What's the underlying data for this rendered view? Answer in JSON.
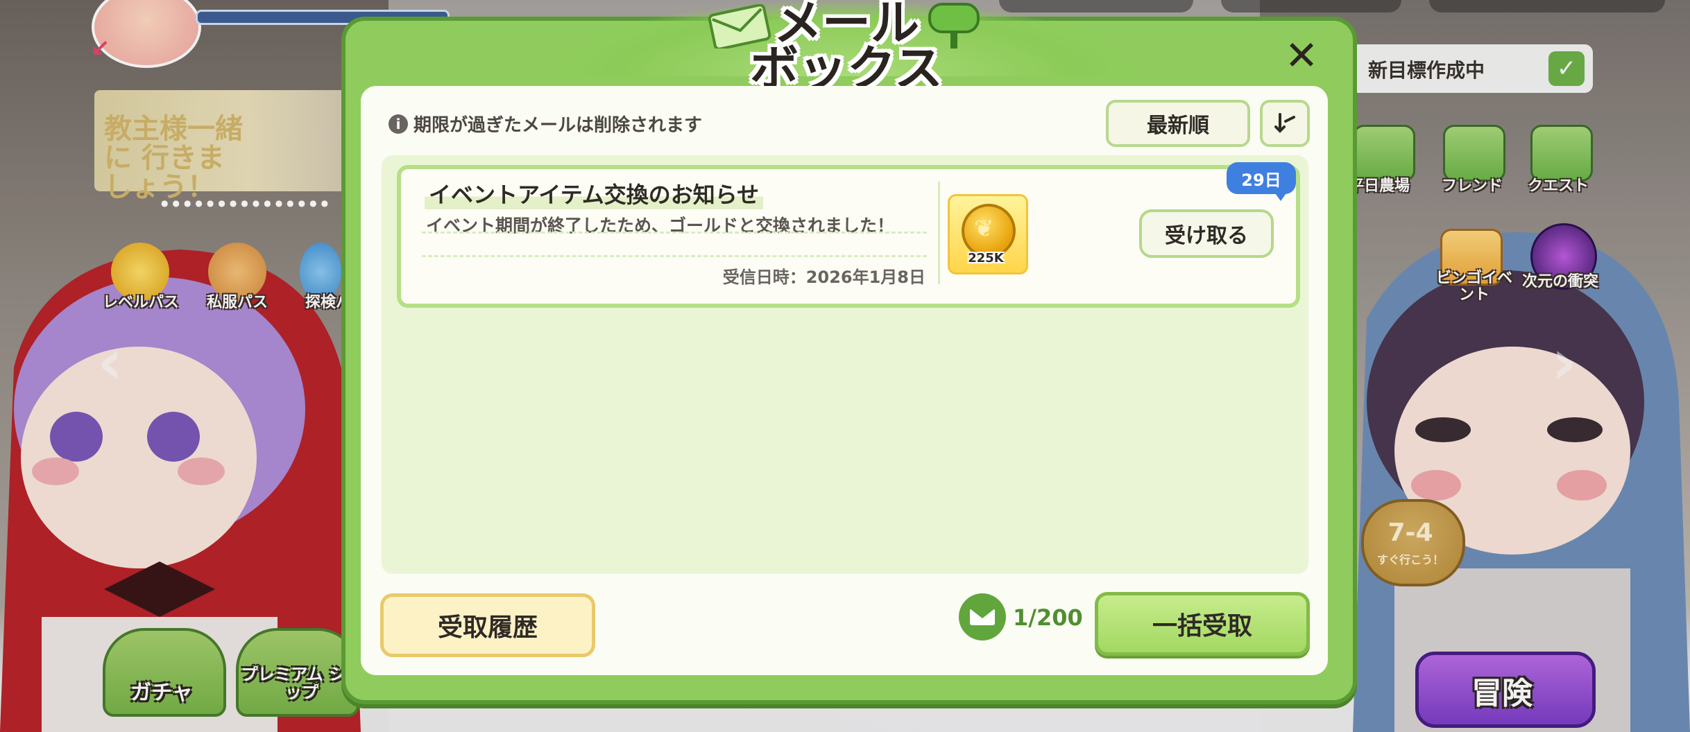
{
  "background": {
    "banner_text": "教主様一緒に 行きましょう！",
    "passes": [
      "レベルパス",
      "私服パス",
      "探検パ"
    ],
    "bottom_buttons": [
      "ガチャ",
      "プレミアム ショップ"
    ],
    "goal": {
      "label": "新目標作成中"
    },
    "menu": [
      "平日農場",
      "フレンド",
      "クエスト",
      "ビンゴイベ ント",
      "次元の衝突"
    ],
    "stage": {
      "number": "7-4",
      "sub": "すぐ行こう！"
    },
    "adventure_label": "冒険"
  },
  "modal": {
    "title_line1": "メール",
    "title_line2": "ボックス",
    "close_symbol": "✕",
    "notice": "期限が過ぎたメールは削除されます",
    "info_symbol": "i",
    "sort_label": "最新順",
    "filter_symbol": "⇣",
    "mail_items": [
      {
        "title": "イベントアイテム交換のお知らせ",
        "body": "イベント期間が終了したため、ゴールドと交換されました！",
        "date": "受信日時：2026年1月8日",
        "reward_qty": "225K",
        "claim_label": "受け取る",
        "days_left": "29日"
      }
    ],
    "history_label": "受取履歴",
    "count": "1/200",
    "claim_all_label": "一括受取"
  },
  "colors": {
    "frame_green": "#8fcc5d",
    "accent_blue": "#3f7fe0",
    "gold": "#ffd54a"
  }
}
